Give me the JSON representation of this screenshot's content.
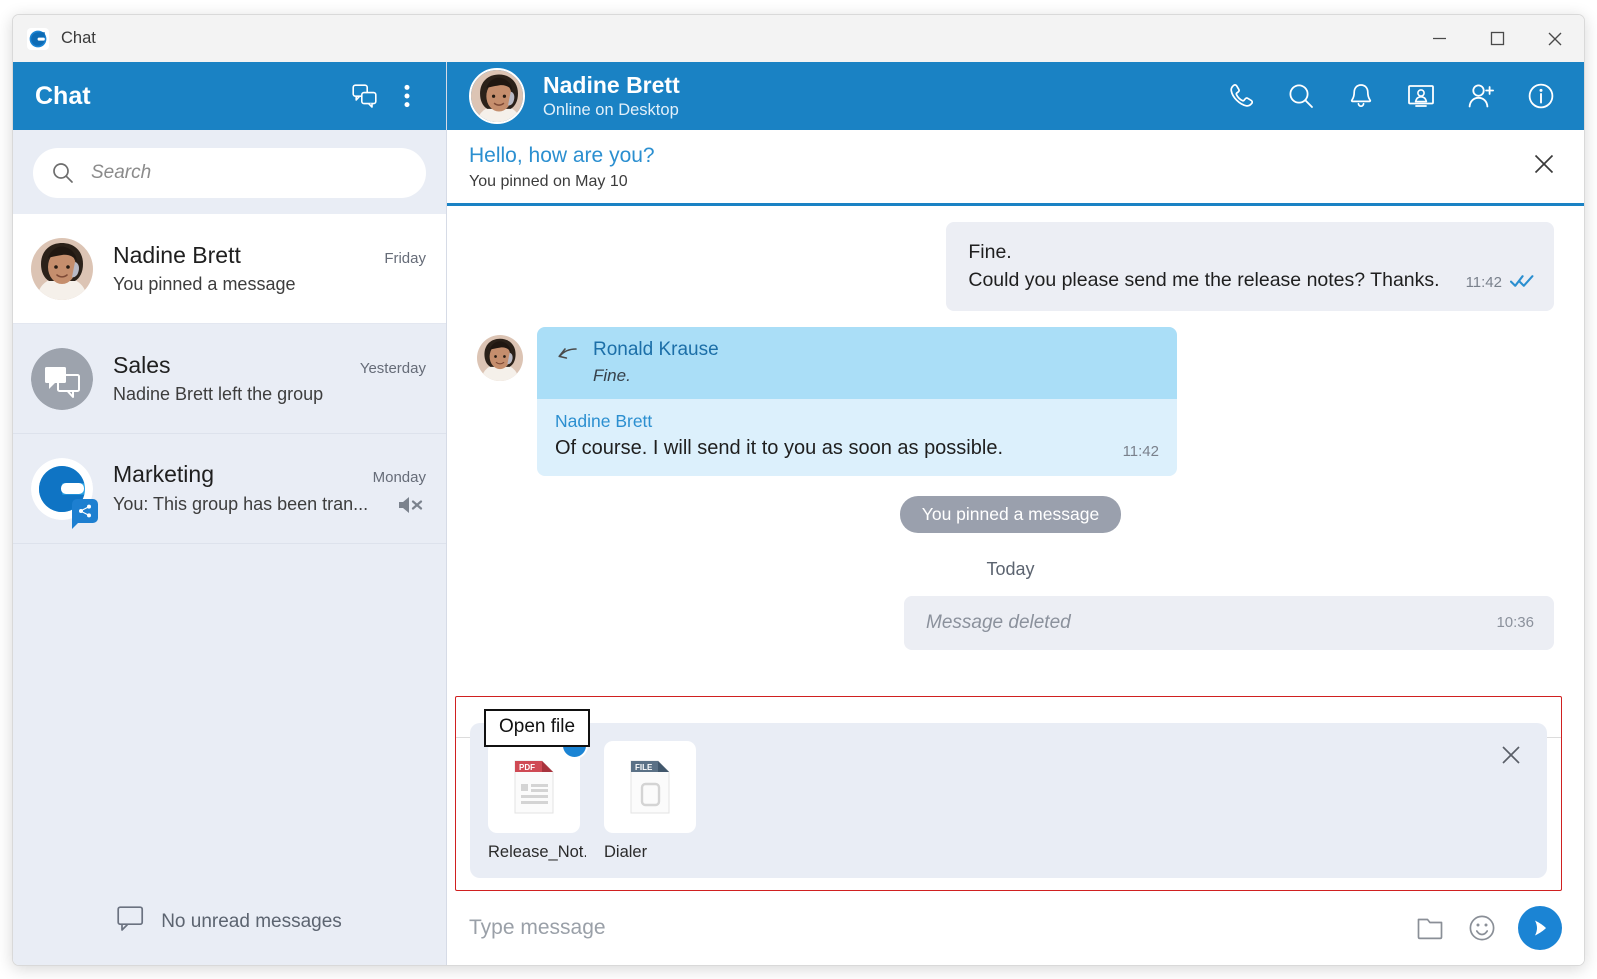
{
  "window": {
    "title": "Chat",
    "app_icon": "g-logo-icon",
    "controls": {
      "minimize": "minimize-icon",
      "maximize": "maximize-icon",
      "close": "close-icon"
    }
  },
  "sidebar": {
    "header": {
      "title": "Chat",
      "new_chat_icon": "chats-icon",
      "menu_icon": "kebab-menu-icon"
    },
    "search": {
      "placeholder": "Search",
      "value": "",
      "icon": "search-icon"
    },
    "chats": [
      {
        "name": "Nadine Brett",
        "time": "Friday",
        "preview": "You pinned a message",
        "avatar": "photo-avatar",
        "active": true,
        "muted": false
      },
      {
        "name": "Sales",
        "time": "Yesterday",
        "preview": "Nadine Brett left the group",
        "avatar": "group-chat-icon",
        "active": false,
        "muted": false
      },
      {
        "name": "Marketing",
        "time": "Monday",
        "preview": "You: This group has been tran...",
        "avatar": "g-logo-avatar",
        "active": false,
        "muted": true,
        "badge": "share-badge-icon"
      }
    ],
    "footer": {
      "text": "No unread messages",
      "icon": "speech-bubble-icon"
    }
  },
  "conversation": {
    "header": {
      "name": "Nadine Brett",
      "status": "Online on Desktop",
      "avatar": "photo-avatar",
      "actions": [
        {
          "name": "call-button",
          "icon": "phone-icon"
        },
        {
          "name": "search-messages-button",
          "icon": "search-icon"
        },
        {
          "name": "notifications-button",
          "icon": "bell-icon"
        },
        {
          "name": "screen-share-button",
          "icon": "screen-share-icon"
        },
        {
          "name": "add-participant-button",
          "icon": "add-person-icon"
        },
        {
          "name": "info-button",
          "icon": "info-icon"
        }
      ]
    },
    "pinned": {
      "message": "Hello, how are you?",
      "meta": "You pinned on May 10",
      "close_icon": "close-icon"
    },
    "messages": [
      {
        "type": "outgoing",
        "lines": [
          "Fine.",
          "Could you please send me the release notes? Thanks."
        ],
        "time": "11:42",
        "receipt": "double-check-icon"
      },
      {
        "type": "incoming-quote",
        "quote_author": "Ronald Krause",
        "quote_text": "Fine.",
        "author": "Nadine Brett",
        "text": "Of course. I will send it to you as soon as possible.",
        "time": "11:42",
        "reply_icon": "reply-arrow-icon"
      },
      {
        "type": "system",
        "text": "You pinned a message"
      },
      {
        "type": "day-separator",
        "text": "Today"
      },
      {
        "type": "deleted",
        "text": "Message deleted",
        "time": "10:36"
      }
    ]
  },
  "attachments": {
    "tooltip": "Open file",
    "close_icon": "close-icon",
    "files": [
      {
        "name": "Release_Not...",
        "kind": "PDF",
        "icon": "pdf-file-icon",
        "removable": true
      },
      {
        "name": "Dialer",
        "kind": "FILE",
        "icon": "generic-file-icon",
        "removable": false
      }
    ]
  },
  "composer": {
    "placeholder": "Type message",
    "value": "",
    "attach_icon": "folder-icon",
    "emoji_icon": "smiley-icon",
    "send_icon": "send-icon"
  },
  "colors": {
    "brand_blue": "#1a82c4",
    "accent_blue": "#1b84d4",
    "sidebar_bg": "#e9edf5",
    "bubble_out": "#eceef4",
    "quote_head": "#aadef7",
    "quote_body": "#dcf0fc",
    "system_pill": "#9aa0ad",
    "highlight_red": "#d02020",
    "pdf_red": "#cf4a54",
    "file_slate": "#5b7186"
  }
}
